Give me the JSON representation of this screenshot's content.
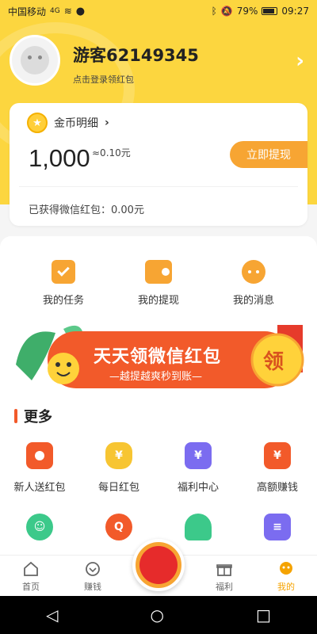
{
  "status_bar": {
    "carrier": "中国移动",
    "signal_text": "4G",
    "battery": "79%",
    "time": "09:27"
  },
  "profile": {
    "username": "游客62149345",
    "login_hint": "点击登录领红包"
  },
  "coin_card": {
    "title": "金币明细",
    "coins": "1,000",
    "approx_value": "≈0.10元",
    "withdraw_button": "立即提现",
    "redpacket_line": "已获得微信红包：0.00元"
  },
  "quick_actions": [
    {
      "label": "我的任务",
      "icon": "clipboard-check-icon"
    },
    {
      "label": "我的提现",
      "icon": "wallet-icon"
    },
    {
      "label": "我的消息",
      "icon": "chat-bubble-icon"
    }
  ],
  "banner": {
    "title": "天天领微信红包",
    "subtitle": "—越提越爽秒到账—",
    "badge": "领"
  },
  "more_section": {
    "title": "更多",
    "items_row1": [
      {
        "label": "新人送红包",
        "icon": "red-envelope-icon"
      },
      {
        "label": "每日红包",
        "icon": "money-bag-icon"
      },
      {
        "label": "福利中心",
        "icon": "ticket-icon"
      },
      {
        "label": "高额赚钱",
        "icon": "gift-box-icon"
      }
    ],
    "items_row2": [
      {
        "label": "",
        "icon": "customer-service-icon"
      },
      {
        "label": "",
        "icon": "question-icon"
      },
      {
        "label": "",
        "icon": "bell-icon"
      },
      {
        "label": "",
        "icon": "document-icon"
      }
    ]
  },
  "tabbar": {
    "tabs": [
      {
        "label": "首页",
        "icon": "home-icon"
      },
      {
        "label": "赚钱",
        "icon": "earn-icon"
      },
      {
        "label": "",
        "icon": "center-redpacket-icon"
      },
      {
        "label": "福利",
        "icon": "gift-icon"
      },
      {
        "label": "我的",
        "icon": "profile-icon"
      }
    ]
  },
  "colors": {
    "brand_yellow": "#fcd63f",
    "accent_orange": "#f7a533",
    "accent_red": "#e62b2b"
  }
}
